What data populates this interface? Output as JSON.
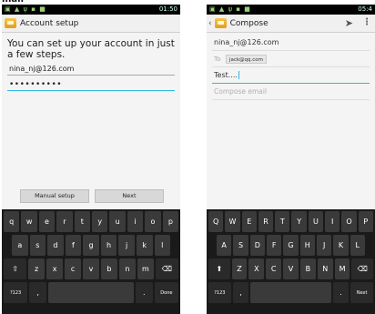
{
  "screen1": {
    "status": {
      "left_icons": "▣ ▲ ψ ▪ ■",
      "time": "01:50"
    },
    "action_bar": {
      "title": "Account setup"
    },
    "message": "You can set up your account in just a few steps.",
    "email_value": "nina_nj@126.com",
    "password_value": "••••••••••",
    "buttons": {
      "manual": "Manual setup",
      "next": "Next"
    },
    "keyboard": {
      "row1": [
        "q",
        "w",
        "e",
        "r",
        "t",
        "y",
        "u",
        "i",
        "o",
        "p"
      ],
      "row2": [
        "a",
        "s",
        "d",
        "f",
        "g",
        "h",
        "j",
        "k",
        "l"
      ],
      "row3": [
        "⇧",
        "z",
        "x",
        "c",
        "v",
        "b",
        "n",
        "m",
        "⌫"
      ],
      "row4": [
        "?123",
        ",",
        "",
        ".",
        "Done"
      ]
    }
  },
  "screen2": {
    "status": {
      "left_icons": "▣ ▲ ψ ▪ ■",
      "time": "05:4"
    },
    "action_bar": {
      "back": "‹",
      "title": "Compose"
    },
    "from_value": "nina_nj@126.com",
    "to_label": "To",
    "to_chip": "jack@qq.com",
    "subject_value": "Test....",
    "body_placeholder": "Compose email",
    "keyboard": {
      "row1": [
        "Q",
        "W",
        "E",
        "R",
        "T",
        "Y",
        "U",
        "I",
        "O",
        "P"
      ],
      "row2": [
        "A",
        "S",
        "D",
        "F",
        "G",
        "H",
        "J",
        "K",
        "L"
      ],
      "row3": [
        "⬆",
        "Z",
        "X",
        "C",
        "V",
        "B",
        "N",
        "M",
        "⌫"
      ],
      "row4": [
        "?123",
        ",",
        "",
        ".",
        "Next"
      ]
    }
  },
  "colors": {
    "accent": "#33b5e5",
    "keyboard_bg": "#1a1a1a",
    "key_bg": "#3a3a3a"
  }
}
